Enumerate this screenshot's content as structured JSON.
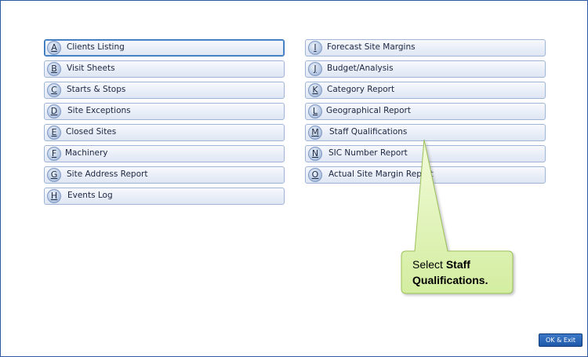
{
  "left_buttons": [
    {
      "key": "A",
      "label": "Clients Listing"
    },
    {
      "key": "B",
      "label": "Visit Sheets"
    },
    {
      "key": "C",
      "label": "Starts & Stops"
    },
    {
      "key": "D",
      "label": "Site Exceptions"
    },
    {
      "key": "E",
      "label": "Closed Sites"
    },
    {
      "key": "F",
      "label": "Machinery"
    },
    {
      "key": "G",
      "label": "Site Address Report"
    },
    {
      "key": "H",
      "label": "Events Log"
    }
  ],
  "right_buttons": [
    {
      "key": "I",
      "label": "Forecast Site Margins"
    },
    {
      "key": "J",
      "label": "Budget/Analysis"
    },
    {
      "key": "K",
      "label": "Category Report"
    },
    {
      "key": "L",
      "label": "Geographical Report"
    },
    {
      "key": "M",
      "label": "Staff Qualifications"
    },
    {
      "key": "N",
      "label": "SIC Number Report"
    },
    {
      "key": "O",
      "label": "Actual Site Margin Report"
    }
  ],
  "ok_button": {
    "label": "OK & Exit"
  },
  "callout": {
    "prefix": "Select ",
    "bold": "Staff Qualifications.",
    "color_fill": "#d6f0a6",
    "color_border": "#9cc25a"
  }
}
